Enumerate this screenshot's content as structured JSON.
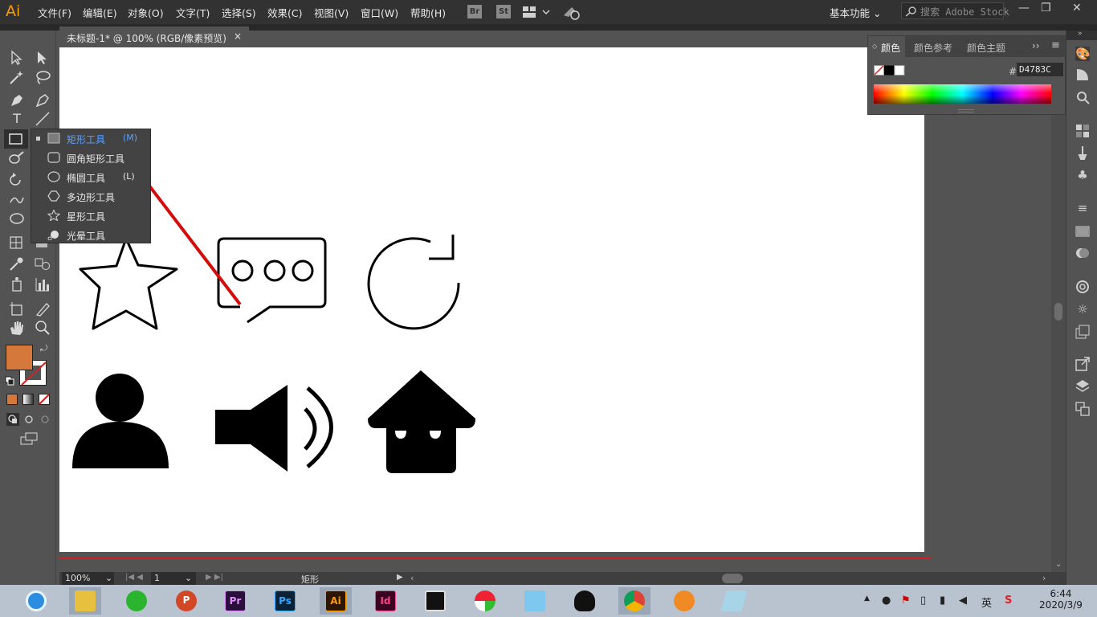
{
  "app": {
    "logo": "Ai",
    "menus": [
      "文件(F)",
      "编辑(E)",
      "对象(O)",
      "文字(T)",
      "选择(S)",
      "效果(C)",
      "视图(V)",
      "窗口(W)",
      "帮助(H)"
    ],
    "bridge_button": "Br",
    "stock_button": "St",
    "workspace_label": "基本功能",
    "search_placeholder": "搜索 Adobe Stock",
    "win_controls": {
      "minimize": "—",
      "restore": "❐",
      "close": "✕"
    }
  },
  "document": {
    "tab_title": "未标题-1* @ 100% (RGB/像素预览)",
    "tab_close": "×"
  },
  "flyout": {
    "items": [
      {
        "label": "矩形工具",
        "key": "(M)",
        "icon": "rectangle-icon",
        "active": true
      },
      {
        "label": "圆角矩形工具",
        "key": "",
        "icon": "rounded-rectangle-icon",
        "active": false
      },
      {
        "label": "椭圆工具",
        "key": "(L)",
        "icon": "ellipse-icon",
        "active": false
      },
      {
        "label": "多边形工具",
        "key": "",
        "icon": "polygon-icon",
        "active": false
      },
      {
        "label": "星形工具",
        "key": "",
        "icon": "star-icon",
        "active": false
      },
      {
        "label": "光晕工具",
        "key": "",
        "icon": "flare-icon",
        "active": false
      }
    ]
  },
  "color_panel": {
    "tabs": [
      "颜色",
      "颜色参考",
      "颜色主题"
    ],
    "hash": "#",
    "hex_value": "D4783C",
    "fill_color": "#d4783c"
  },
  "status": {
    "zoom": "100%",
    "page": "1",
    "tool_name": "矩形"
  },
  "taskbar": {
    "apps": [
      {
        "name": "browser-360",
        "label": ""
      },
      {
        "name": "file-explorer",
        "label": ""
      },
      {
        "name": "wechat",
        "label": ""
      },
      {
        "name": "powerpoint",
        "label": "P"
      },
      {
        "name": "premiere",
        "label": "Pr"
      },
      {
        "name": "photoshop",
        "label": "Ps"
      },
      {
        "name": "illustrator",
        "label": "Ai"
      },
      {
        "name": "indesign",
        "label": "Id"
      },
      {
        "name": "video-editor",
        "label": ""
      },
      {
        "name": "umbrella-app",
        "label": ""
      },
      {
        "name": "cat-app",
        "label": ""
      },
      {
        "name": "qq",
        "label": ""
      },
      {
        "name": "chrome",
        "label": ""
      },
      {
        "name": "orange-app",
        "label": ""
      },
      {
        "name": "eraser-app",
        "label": ""
      }
    ],
    "ime": "英",
    "time": "6:44",
    "date": "2020/3/9"
  }
}
